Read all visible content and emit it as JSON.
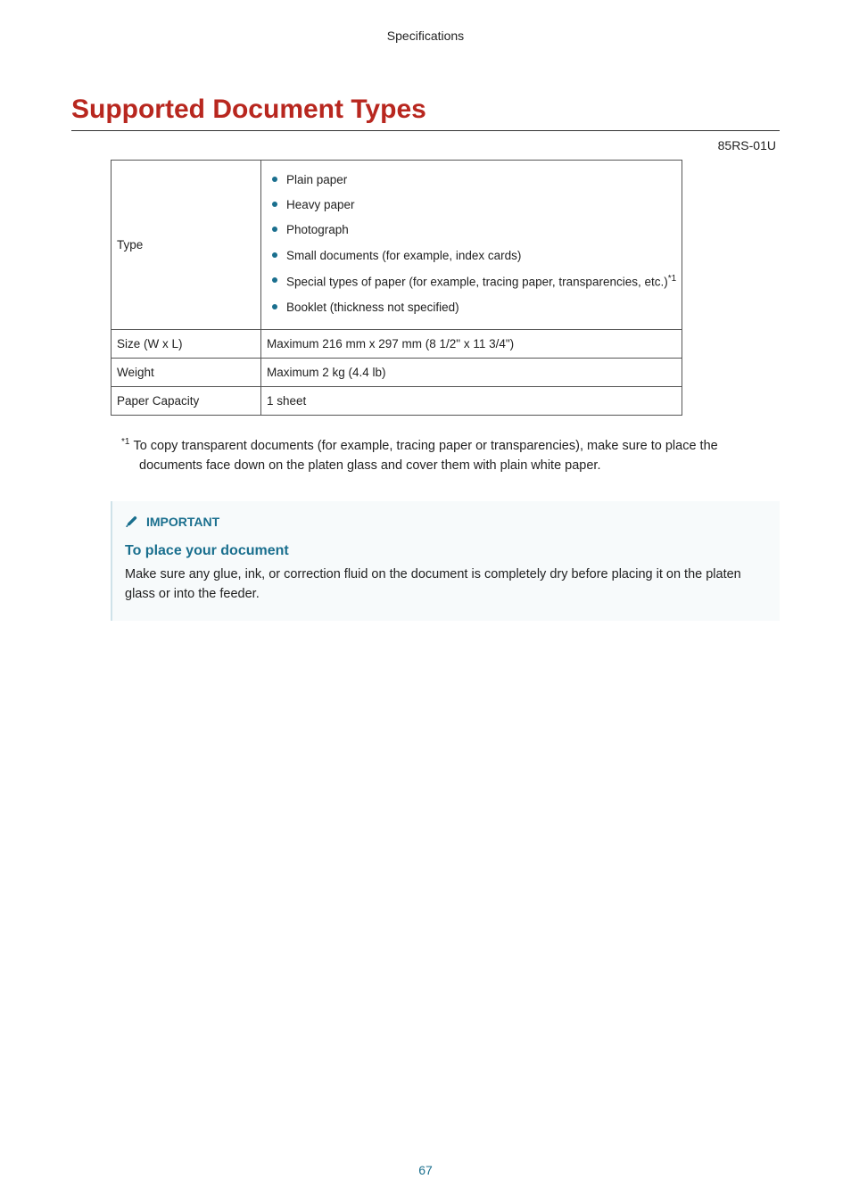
{
  "header": {
    "section": "Specifications"
  },
  "title": "Supported Document Types",
  "doc_code": "85RS-01U",
  "table": {
    "rows": [
      {
        "label": "Type",
        "items": [
          "Plain paper",
          "Heavy paper",
          "Photograph",
          "Small documents (for example, index cards)",
          "Special types of paper (for example, tracing paper, transparencies, etc.)",
          "Booklet (thickness not specified)"
        ],
        "special_index_with_ref": 4,
        "ref_marker": "*1"
      },
      {
        "label": "Size (W x L)",
        "value": "Maximum 216 mm x 297 mm (8 1/2\" x 11 3/4\")"
      },
      {
        "label": "Weight",
        "value": "Maximum 2 kg (4.4 lb)"
      },
      {
        "label": "Paper Capacity",
        "value": "1 sheet"
      }
    ]
  },
  "footnote": {
    "marker": "*1",
    "text": "To copy transparent documents (for example, tracing paper or transparencies), make sure to place the documents face down on the platen glass and cover them with plain white paper."
  },
  "important": {
    "label": "IMPORTANT",
    "subheading": "To place your document",
    "body": "Make sure any glue, ink, or correction fluid on the document is completely dry before placing it on the platen glass or into the feeder."
  },
  "page_number": "67"
}
